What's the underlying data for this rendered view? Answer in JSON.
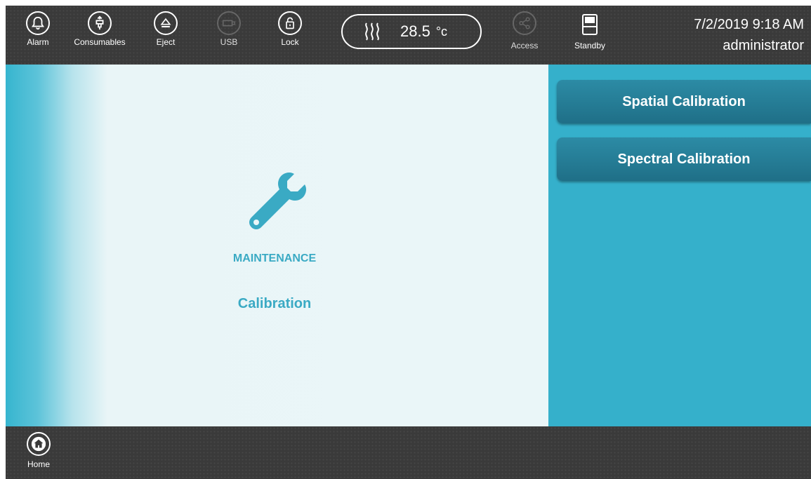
{
  "topbar": {
    "buttons": [
      {
        "label": "Alarm",
        "icon": "bell-icon",
        "enabled": true
      },
      {
        "label": "Consumables",
        "icon": "consumables-icon",
        "enabled": true
      },
      {
        "label": "Eject",
        "icon": "eject-icon",
        "enabled": true
      },
      {
        "label": "USB",
        "icon": "usb-icon",
        "enabled": false
      },
      {
        "label": "Lock",
        "icon": "unlock-icon",
        "enabled": true
      },
      {
        "label": "Access",
        "icon": "share-icon",
        "enabled": false
      },
      {
        "label": "Standby",
        "icon": "standby-icon",
        "enabled": true
      }
    ],
    "temperature": {
      "value": "28.5",
      "unit": "°c",
      "icon": "heat-icon"
    },
    "datetime": "7/2/2019 9:18 AM",
    "user": "administrator"
  },
  "main": {
    "icon": "wrench-icon",
    "section": "MAINTENANCE",
    "page": "Calibration",
    "accent_color": "#3aaac4"
  },
  "right_panel": {
    "buttons": [
      {
        "label": "Spatial Calibration"
      },
      {
        "label": "Spectral Calibration"
      }
    ],
    "color": "#35b0cb"
  },
  "bottombar": {
    "home_label": "Home",
    "home_icon": "home-icon"
  }
}
